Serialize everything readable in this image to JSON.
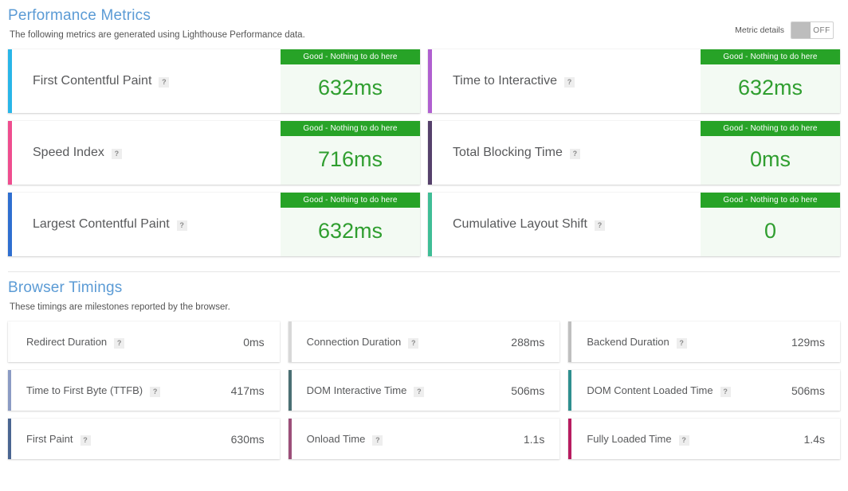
{
  "performance": {
    "title": "Performance Metrics",
    "subtitle": "The following metrics are generated using Lighthouse Performance data.",
    "toggle": {
      "label": "Metric details",
      "state": "OFF"
    },
    "help_glyph": "?",
    "cards": [
      {
        "label": "First Contentful Paint",
        "badge": "Good - Nothing to do here",
        "value": "632ms",
        "accent": "#29b6e8"
      },
      {
        "label": "Time to Interactive",
        "badge": "Good - Nothing to do here",
        "value": "632ms",
        "accent": "#b05fd0"
      },
      {
        "label": "Speed Index",
        "badge": "Good - Nothing to do here",
        "value": "716ms",
        "accent": "#ef4d8f"
      },
      {
        "label": "Total Blocking Time",
        "badge": "Good - Nothing to do here",
        "value": "0ms",
        "accent": "#55406b"
      },
      {
        "label": "Largest Contentful Paint",
        "badge": "Good - Nothing to do here",
        "value": "632ms",
        "accent": "#2f6fd0"
      },
      {
        "label": "Cumulative Layout Shift",
        "badge": "Good - Nothing to do here",
        "value": "0",
        "accent": "#3fbd96"
      }
    ]
  },
  "browser_timings": {
    "title": "Browser Timings",
    "subtitle": "These timings are milestones reported by the browser.",
    "help_glyph": "?",
    "cards": [
      {
        "label": "Redirect Duration",
        "value": "0ms",
        "accent": "#fdfdfd"
      },
      {
        "label": "Connection Duration",
        "value": "288ms",
        "accent": "#d8d8d8"
      },
      {
        "label": "Backend Duration",
        "value": "129ms",
        "accent": "#bfbfbf"
      },
      {
        "label": "Time to First Byte (TTFB)",
        "value": "417ms",
        "accent": "#8b9bc4"
      },
      {
        "label": "DOM Interactive Time",
        "value": "506ms",
        "accent": "#4a6f73"
      },
      {
        "label": "DOM Content Loaded Time",
        "value": "506ms",
        "accent": "#2e8f8f"
      },
      {
        "label": "First Paint",
        "value": "630ms",
        "accent": "#4a6591"
      },
      {
        "label": "Onload Time",
        "value": "1.1s",
        "accent": "#9c4f79"
      },
      {
        "label": "Fully Loaded Time",
        "value": "1.4s",
        "accent": "#b81c60"
      }
    ]
  }
}
